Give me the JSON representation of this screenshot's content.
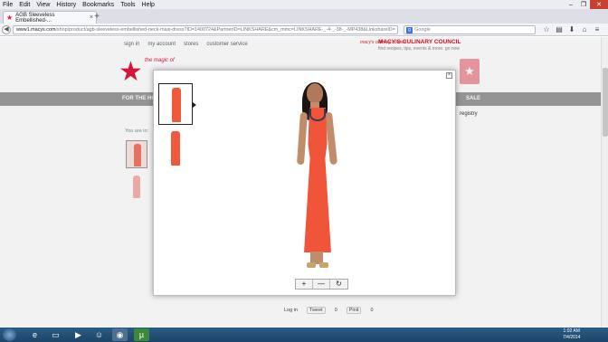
{
  "menubar": [
    "File",
    "Edit",
    "View",
    "History",
    "Bookmarks",
    "Tools",
    "Help"
  ],
  "tab": {
    "title": "AGB Sleeveless Embellished-..."
  },
  "nav": {
    "url_domain": "www1.macys.com",
    "url_rest": "/shop/product/agb-sleeveless-embellished-neck-maxi-dress?ID=1400724&PartnerID=LINKSHARE&cm_mmc=LINKSHARE-_-4-_-38-_-MP438&LinkshareID=",
    "search_placeholder": "Google"
  },
  "page": {
    "toplinks": [
      "sign in",
      "my account",
      "stores",
      "customer service"
    ],
    "culinary_title": "MACY'S CULINARY COUNCIL",
    "culinary_sub": "find recipes, tips, events & more. go now",
    "culinary_logo": "macy's culinary council",
    "macys_tagline": "the magic of",
    "nav_left": "FOR THE HO",
    "nav_right": "SALE",
    "registry": "registry",
    "breadcrumb": "You are in:",
    "share": [
      "Log in",
      "Tweet",
      "0",
      "Pinit",
      "0"
    ]
  },
  "modal": {
    "close": "×",
    "zoom_in": "+",
    "zoom_out": "—",
    "reset": "↻"
  },
  "taskbar": {
    "time": "1:02 AM",
    "date": "7/4/2014"
  },
  "colors": {
    "brand": "#e3173e",
    "dress": "#f0553a",
    "navgray": "#9c9c9c"
  }
}
